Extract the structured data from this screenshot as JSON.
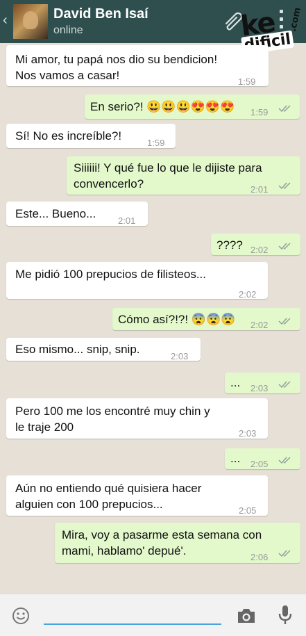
{
  "header": {
    "back_glyph": "‹",
    "contact_name": "David Ben Isaí",
    "status": "online"
  },
  "watermark": {
    "ke": "ke",
    "dificil": "dificil",
    "com": ".com"
  },
  "messages": [
    {
      "dir": "in",
      "text": "Mi amor, tu papá nos dio su bendicion!\nNos vamos a casar!",
      "time": "1:59"
    },
    {
      "dir": "out",
      "text": "En serio?! 😃😃😃😍😍😍",
      "time": "1:59",
      "ticks": "read"
    },
    {
      "dir": "in",
      "text": "Sí! No es increíble?!",
      "time": "1:59"
    },
    {
      "dir": "out",
      "text": "Siiiiii! Y qué fue lo que le dijiste para\nconvencerlo?",
      "time": "2:01",
      "ticks": "read"
    },
    {
      "dir": "in",
      "text": "Este... Bueno...",
      "time": "2:01"
    },
    {
      "dir": "out",
      "text": "????",
      "time": "2:02",
      "ticks": "read"
    },
    {
      "dir": "in",
      "text": "Me pidió 100 prepucios de filisteos...",
      "time": "2:02"
    },
    {
      "dir": "out",
      "text": "Cómo así?!?! 😨😨😨",
      "time": "2:02",
      "ticks": "read"
    },
    {
      "dir": "in",
      "text": "Eso mismo... snip, snip.",
      "time": "2:03"
    },
    {
      "dir": "out",
      "text": "...",
      "time": "2:03",
      "ticks": "read"
    },
    {
      "dir": "in",
      "text": "Pero 100 me los encontré muy chin y\nle traje 200",
      "time": "2:03"
    },
    {
      "dir": "out",
      "text": "...",
      "time": "2:05",
      "ticks": "read"
    },
    {
      "dir": "in",
      "text": "Aún no entiendo qué quisiera hacer\nalguien con 100 prepucios...",
      "time": "2:05"
    },
    {
      "dir": "out",
      "text": "Mira, voy a pasarme esta semana con\nmami, hablamo' depué'.",
      "time": "2:06",
      "ticks": "read"
    }
  ],
  "composer": {
    "value": ""
  },
  "icons": [
    "back-icon",
    "avatar",
    "attach-icon",
    "menu-icon",
    "smiley-icon",
    "camera-icon",
    "mic-icon",
    "double-check-icon"
  ],
  "colors": {
    "header": "#2f4f4f",
    "incoming": "#ffffff",
    "outgoing": "#e3f8cb",
    "background": "#e6e0d6",
    "ticks": "#8fa39a",
    "input_line": "#4aa3df"
  }
}
